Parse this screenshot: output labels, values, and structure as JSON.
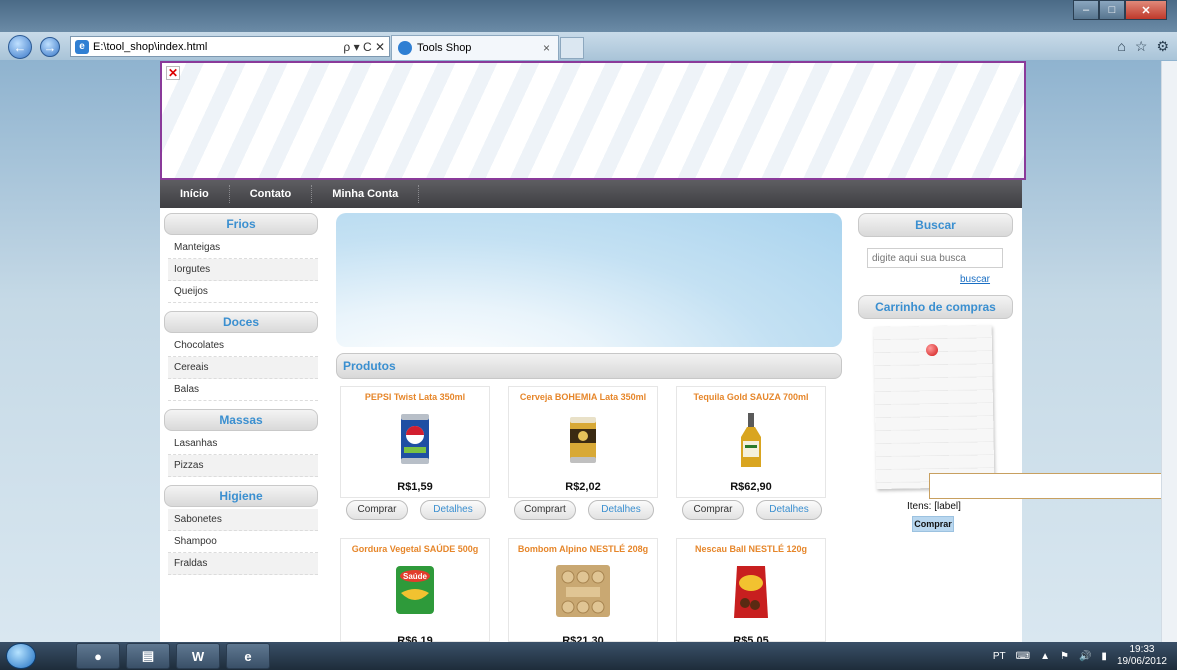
{
  "browser": {
    "url": "E:\\tool_shop\\index.html",
    "url_controls": "ρ ▾ C ✕",
    "tab_title": "Tools Shop",
    "tab_close": "×",
    "toolbar_icons": [
      "home-icon",
      "star-icon",
      "gear-icon"
    ]
  },
  "nav": {
    "items": [
      "Início",
      "Contato",
      "Minha Conta"
    ]
  },
  "categories": [
    {
      "title": "Frios",
      "items": [
        "Manteigas",
        "Iorgutes",
        "Queijos"
      ]
    },
    {
      "title": "Doces",
      "items": [
        "Chocolates",
        "Cereais",
        "Balas"
      ]
    },
    {
      "title": "Massas",
      "items": [
        "Lasanhas",
        "Pizzas"
      ]
    },
    {
      "title": "Higiene",
      "items": [
        "Sabonetes",
        "Shampoo",
        "Fraldas"
      ]
    }
  ],
  "products_header": "Produtos",
  "products": [
    {
      "name": "PEPSI Twist Lata 350ml",
      "price": "R$1,59",
      "buy": "Comprar",
      "details": "Detalhes"
    },
    {
      "name": "Cerveja BOHEMIA Lata 350ml",
      "price": "R$2,02",
      "buy": "Comprart",
      "details": "Detalhes"
    },
    {
      "name": "Tequila Gold SAUZA 700ml",
      "price": "R$62,90",
      "buy": "Comprar",
      "details": "Detalhes"
    },
    {
      "name": "Gordura Vegetal SAÚDE 500g",
      "price": "R$6,19"
    },
    {
      "name": "Bombom Alpino NESTLÉ 208g",
      "price": "R$21,30"
    },
    {
      "name": "Nescau Ball NESTLÉ 120g",
      "price": "R$5,05"
    }
  ],
  "search": {
    "title": "Buscar",
    "placeholder": "digite aqui sua busca",
    "link": "buscar"
  },
  "cart": {
    "title": "Carrinho de compras",
    "items_label": "Itens: [label]",
    "buy_label": "Comprar"
  },
  "taskbar": {
    "lang": "PT",
    "time": "19:33",
    "date": "19/06/2012",
    "apps": [
      "explorer",
      "word",
      "internet-explorer"
    ]
  },
  "colors": {
    "accent_blue": "#3a8fd0",
    "product_orange": "#e6862a",
    "nav_dark": "#4a4a4e",
    "banner_border": "#8a3a9a"
  }
}
